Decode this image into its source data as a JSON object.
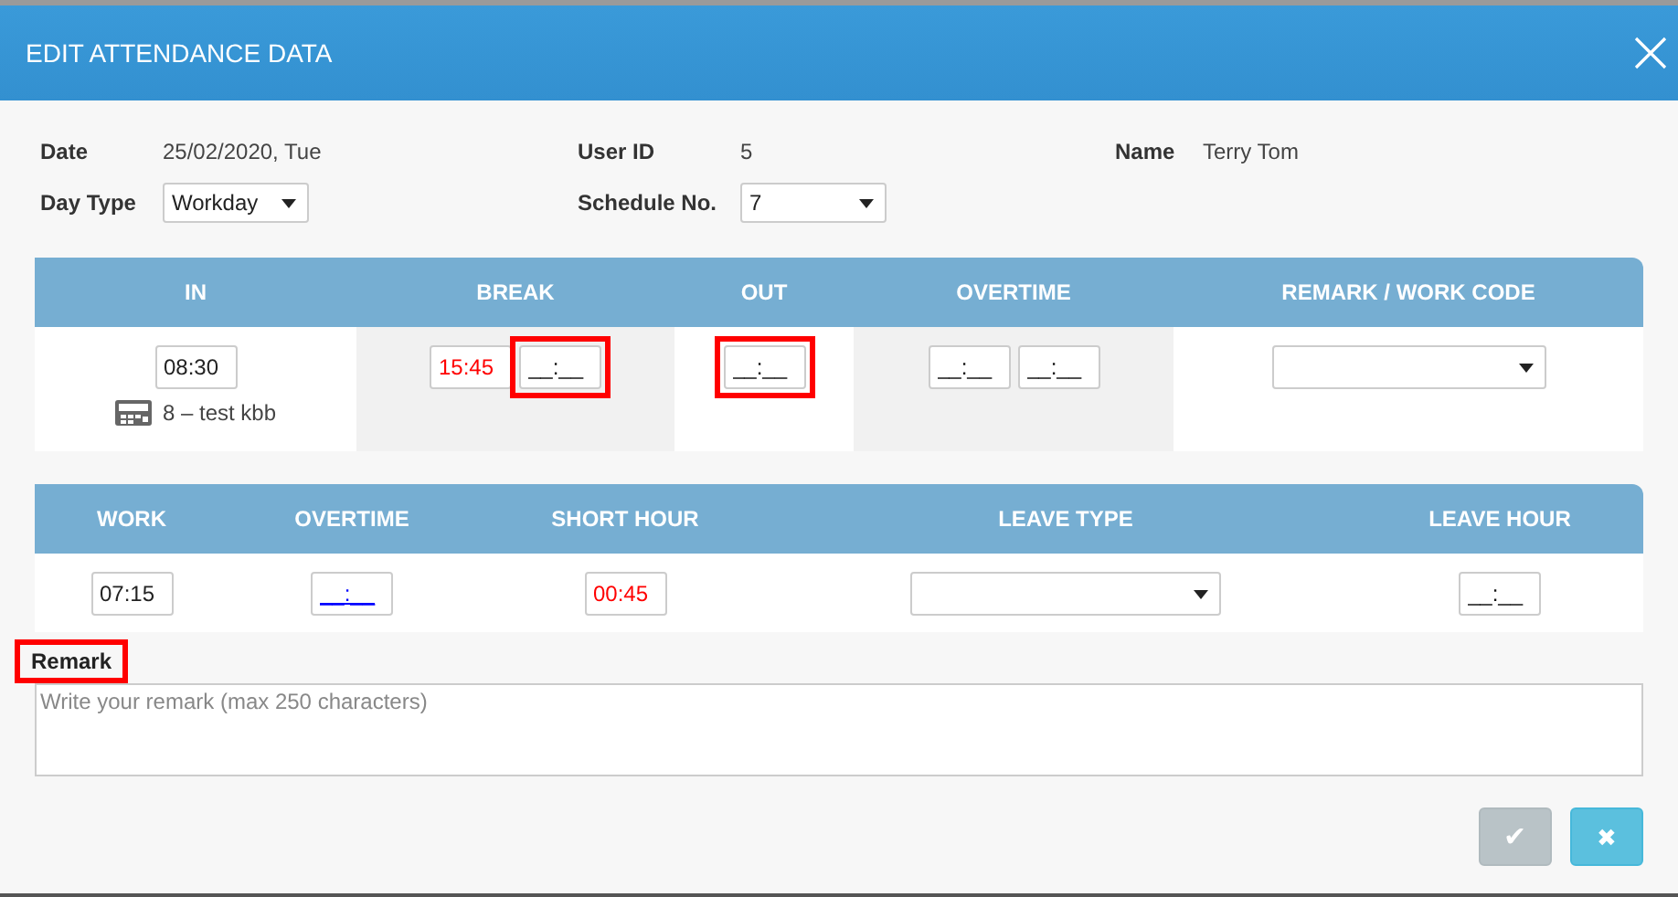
{
  "dialog": {
    "title": "EDIT ATTENDANCE DATA"
  },
  "info_rows": [
    [
      {
        "label": "Date",
        "kind": "text",
        "value": "25/02/2020, Tue"
      },
      {
        "label": "User ID",
        "kind": "text",
        "value": "5"
      },
      {
        "label": "Name",
        "kind": "text",
        "value": "Terry Tom"
      }
    ],
    [
      {
        "label": "Day Type",
        "kind": "select",
        "value": "Workday"
      },
      {
        "label": "Schedule No.",
        "kind": "select",
        "value": "7"
      }
    ]
  ],
  "attendance_table": {
    "columns": [
      {
        "heading": "IN",
        "shaded": false,
        "fields": [
          {
            "kind": "time",
            "value": "08:30",
            "warning": false,
            "linked": false,
            "highlighted": false
          }
        ],
        "device": "8 – test kbb"
      },
      {
        "heading": "BREAK",
        "shaded": true,
        "fields": [
          {
            "kind": "time",
            "value": "15:45",
            "warning": true,
            "linked": false,
            "highlighted": false
          },
          {
            "kind": "time",
            "placeholder": "__:__",
            "warning": false,
            "linked": false,
            "highlighted": true
          }
        ]
      },
      {
        "heading": "OUT",
        "shaded": false,
        "fields": [
          {
            "kind": "time",
            "placeholder": "__:__",
            "warning": false,
            "linked": false,
            "highlighted": true
          }
        ]
      },
      {
        "heading": "OVERTIME",
        "shaded": true,
        "fields": [
          {
            "kind": "time",
            "placeholder": "__:__",
            "warning": false,
            "linked": false,
            "highlighted": false
          },
          {
            "kind": "time",
            "placeholder": "__:__",
            "warning": false,
            "linked": false,
            "highlighted": false
          }
        ]
      },
      {
        "heading": "REMARK / WORK CODE",
        "shaded": false,
        "fields": [
          {
            "kind": "select",
            "highlighted": false
          }
        ]
      }
    ]
  },
  "summary_table": {
    "columns": [
      {
        "heading": "WORK",
        "fields": [
          {
            "kind": "time",
            "value": "07:15",
            "warning": false,
            "linked": false,
            "highlighted": false
          }
        ]
      },
      {
        "heading": "OVERTIME",
        "fields": [
          {
            "kind": "time",
            "placeholder": "__:__",
            "warning": false,
            "linked": true,
            "highlighted": false
          }
        ]
      },
      {
        "heading": "SHORT HOUR",
        "fields": [
          {
            "kind": "time",
            "value": "00:45",
            "warning": true,
            "linked": false,
            "highlighted": false
          }
        ]
      },
      {
        "heading": "LEAVE TYPE",
        "fields": [
          {
            "kind": "select",
            "highlighted": false
          }
        ]
      },
      {
        "heading": "LEAVE HOUR",
        "fields": [
          {
            "kind": "time",
            "placeholder": "__:__",
            "warning": false,
            "linked": false,
            "highlighted": false
          }
        ]
      }
    ]
  },
  "remark": {
    "label": "Remark",
    "highlighted": true,
    "placeholder": "Write your remark (max 250 characters)"
  },
  "buttons": [
    {
      "kind": "confirm",
      "glyph": "✔",
      "disabled": true
    },
    {
      "kind": "cancel",
      "glyph": "✖",
      "disabled": false
    }
  ]
}
